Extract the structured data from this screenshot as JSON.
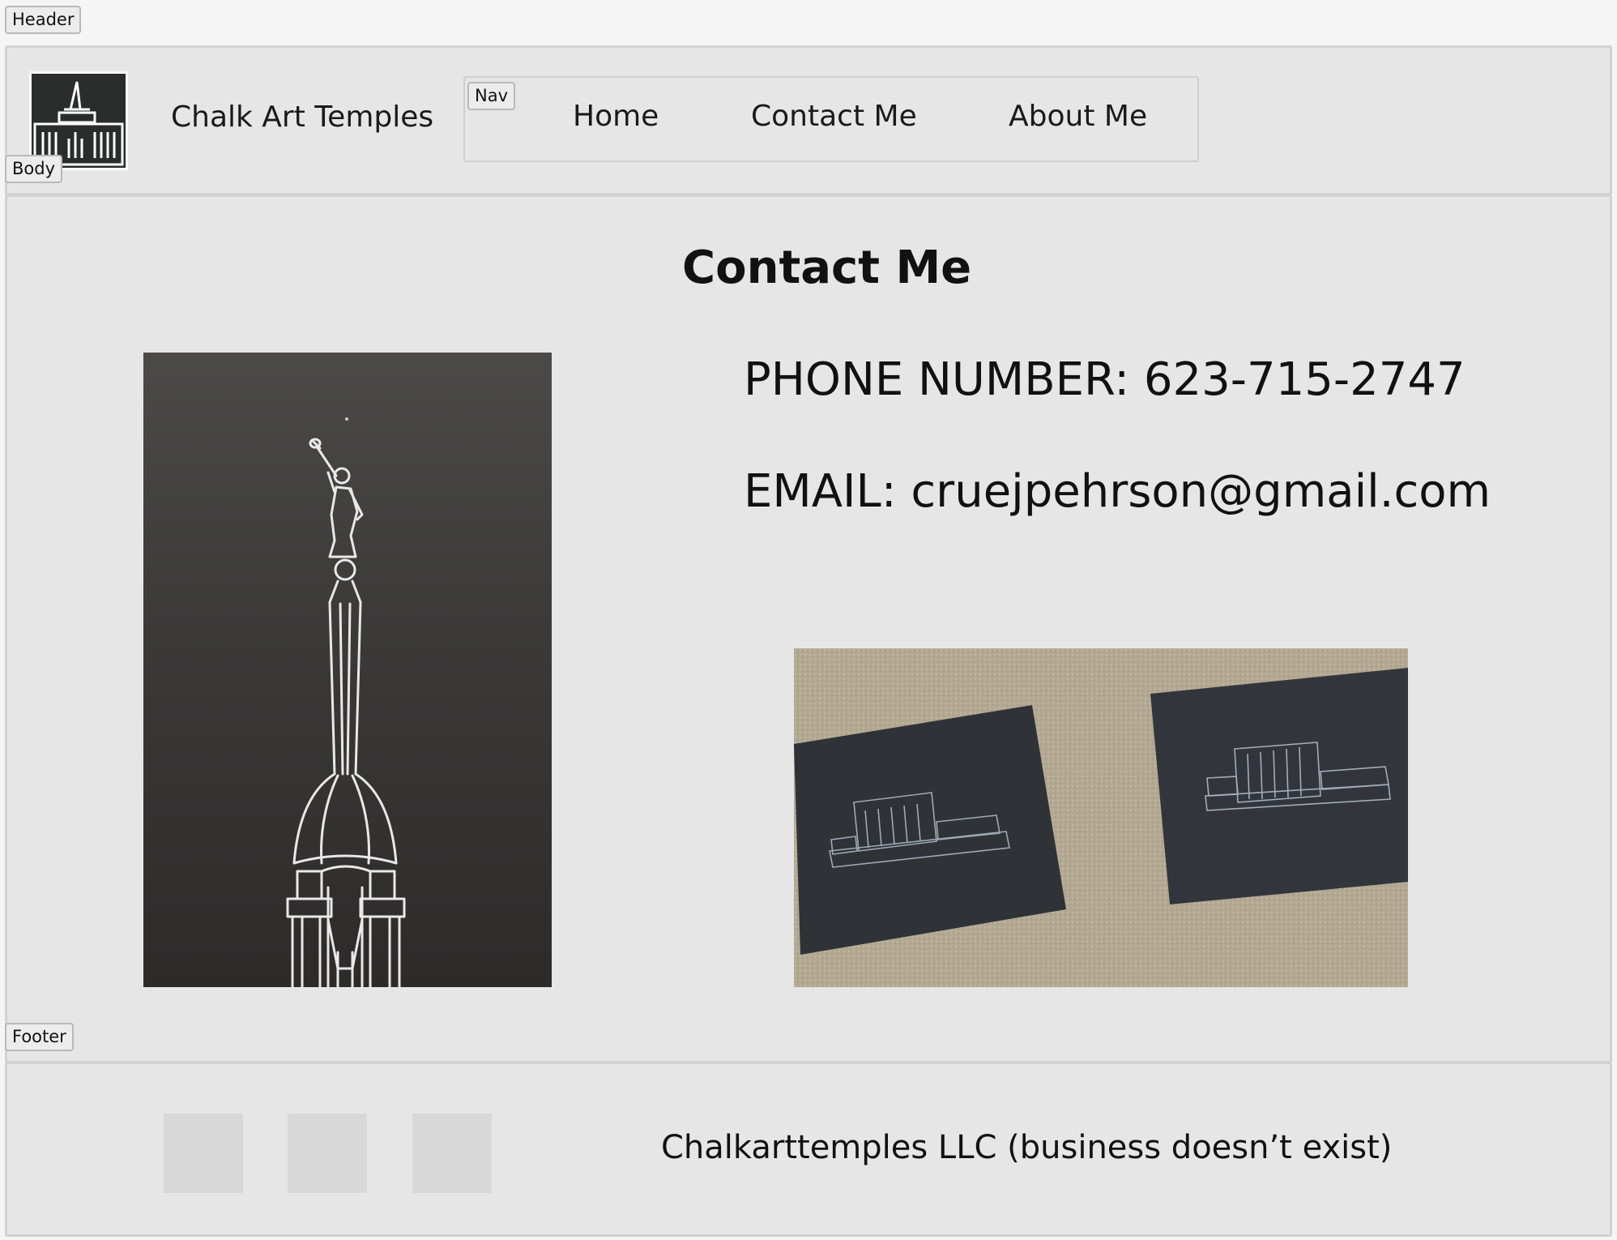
{
  "annotations": {
    "header": "Header",
    "body": "Body",
    "nav": "Nav",
    "footer": "Footer"
  },
  "header": {
    "site_title": "Chalk Art Temples",
    "logo_icon": "temple-icon"
  },
  "nav": {
    "items": [
      {
        "label": "Home"
      },
      {
        "label": "Contact Me"
      },
      {
        "label": "About Me"
      }
    ]
  },
  "main": {
    "title": "Contact Me",
    "phone": "PHONE NUMBER: 623-715-2747",
    "email": "EMAIL: cruejpehrson@gmail.com",
    "images": [
      {
        "subject": "chalk drawing of temple spire with angel statue"
      },
      {
        "subject": "two chalk temple drawings on black paper on carpet"
      }
    ]
  },
  "footer": {
    "social_placeholders": 3,
    "text": "Chalkarttemples LLC (business doesn’t exist)"
  },
  "colors": {
    "page_bg": "#f5f5f5",
    "section_bg": "#e6e6e6",
    "placeholder": "#d8d8d8",
    "logo_bg": "#2a2d2b"
  }
}
